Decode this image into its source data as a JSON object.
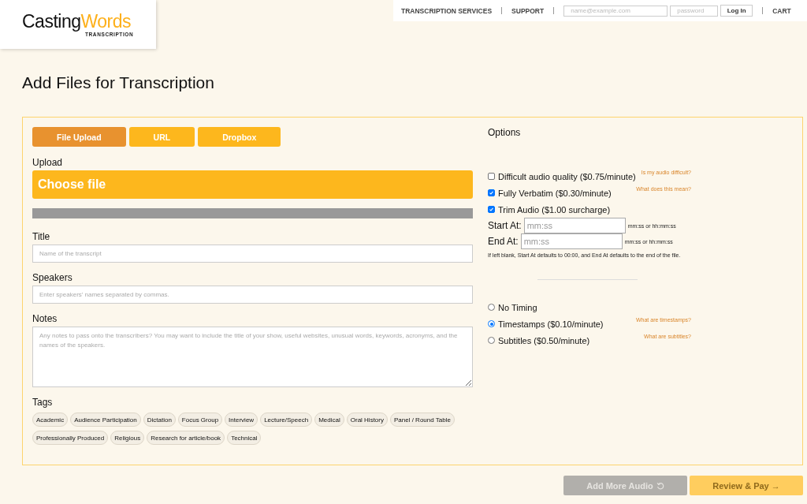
{
  "logo": {
    "name_first": "Casting",
    "name_second": "Words",
    "tagline": "TRANSCRIPTION"
  },
  "nav": {
    "links": [
      "TRANSCRIPTION SERVICES",
      "SUPPORT"
    ],
    "email": {
      "placeholder": "name@example.com"
    },
    "password": {
      "placeholder": "password"
    },
    "login_button": "Log In",
    "cart": "CART"
  },
  "page_title": "Add Files for Transcription",
  "source_tabs": [
    {
      "label": "File Upload",
      "selected": true
    },
    {
      "label": "URL",
      "selected": false
    },
    {
      "label": "Dropbox",
      "selected": false
    }
  ],
  "upload": {
    "label": "Upload",
    "button": "Choose file"
  },
  "fields": [
    {
      "label": "Title",
      "kind": "input",
      "placeholder": "Name of the transcript"
    },
    {
      "label": "Speakers",
      "kind": "input",
      "placeholder": "Enter speakers' names separated by commas."
    },
    {
      "label": "Notes",
      "kind": "textarea",
      "placeholder": "Any notes to pass onto the transcribers? You may want to include the title of your show, useful websites, unusual words, keywords, acronyms, and the names of the speakers."
    }
  ],
  "tags": {
    "label": "Tags",
    "items": [
      "Academic",
      "Audience Participation",
      "Dictation",
      "Focus Group",
      "Interview",
      "Lecture/Speech",
      "Medical",
      "Oral History",
      "Panel / Round Table",
      "Professionally Produced",
      "Religious",
      "Research for article/book",
      "Technical"
    ]
  },
  "options": {
    "heading": "Options",
    "checkboxes": [
      {
        "label": "Difficult audio quality ($0.75/minute)",
        "checked": false,
        "help": "Is my audio difficult?"
      },
      {
        "label": "Fully Verbatim ($0.30/minute)",
        "checked": true,
        "help": "What does this mean?"
      },
      {
        "label": "Trim Audio ($1.00 surcharge)",
        "checked": true
      }
    ],
    "trim": [
      {
        "label": "Start At:",
        "placeholder": "mm:ss",
        "hint": "mm:ss or hh:mm:ss"
      },
      {
        "label": "End At:",
        "placeholder": "mm:ss",
        "hint": "mm:ss or hh:mm:ss"
      }
    ],
    "trim_note": "If left blank, Start At defaults to 00:00, and End At defaults to the end of the file.",
    "timing": [
      {
        "label": "No Timing",
        "selected": false
      },
      {
        "label": "Timestamps ($0.10/minute)",
        "selected": true,
        "help": "What are timestamps?"
      },
      {
        "label": "Subtitles ($0.50/minute)",
        "selected": false,
        "help": "What are subtitles?"
      }
    ]
  },
  "actions": [
    {
      "label": "Add More Audio",
      "kind": "add",
      "disabled": true
    },
    {
      "label": "Review & Pay →",
      "kind": "proceed",
      "disabled": true
    }
  ]
}
